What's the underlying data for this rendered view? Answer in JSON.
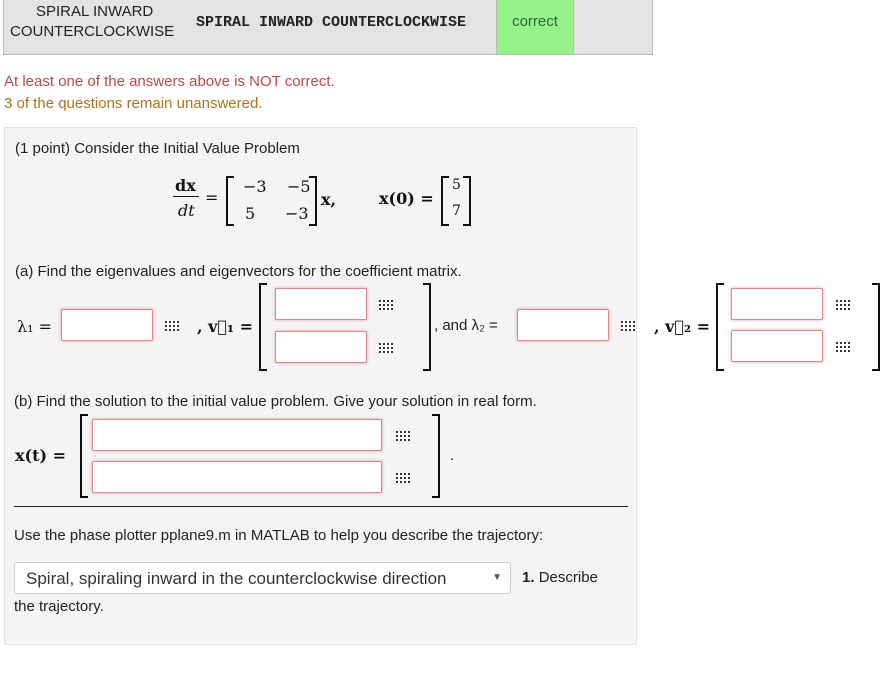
{
  "results": {
    "entered": "SPIRAL INWARD COUNTERCLOCKWISE",
    "entered_line1": "SPIRAL INWARD",
    "entered_line2": "COUNTERCLOCKWISE",
    "preview": "SPIRAL INWARD COUNTERCLOCKWISE",
    "status": "correct"
  },
  "messages": {
    "not_correct": "At least one of the answers above is NOT correct.",
    "unanswered": "3 of the questions remain unanswered."
  },
  "problem": {
    "intro": "(1 point) Consider the Initial Value Problem",
    "equation": {
      "lhs_num": "dx",
      "lhs_den": "dt",
      "matrix": [
        "−3",
        "−5",
        "5",
        "−3"
      ],
      "var": "x,",
      "ic_label": "x(0) =",
      "ic_vector": [
        "5",
        "7"
      ]
    },
    "part_a": "(a) Find the eigenvalues and eigenvectors for the coefficient matrix.",
    "lambda1": "λ₁ =",
    "v1": ", v⃗₁ =",
    "and_lambda2": ", and λ₂ =",
    "v2": ", v⃗₂ =",
    "part_b": "(b) Find the solution to the initial value problem. Give your solution in real form.",
    "xt": "x(t) =",
    "period": ".",
    "phase_text": "Use the phase plotter pplane9.m in MATLAB to help you describe the trajectory:",
    "select_value": "Spiral, spiraling inward in the counterclockwise direction",
    "describe_num": "1.",
    "describe_label": "Describe",
    "describe_tail": "the trajectory."
  }
}
